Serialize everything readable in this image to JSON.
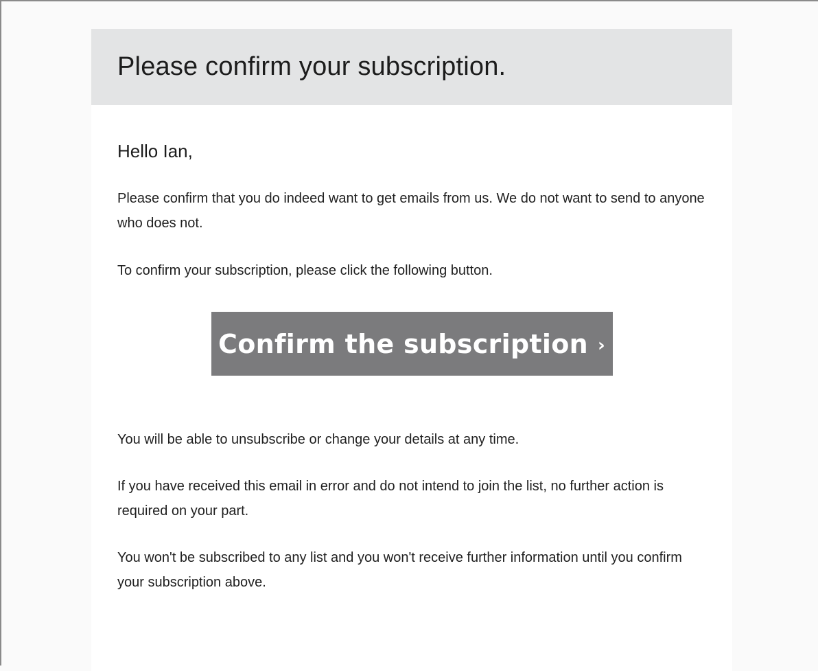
{
  "email": {
    "title": "Please confirm your subscription.",
    "greeting": "Hello Ian,",
    "paragraph_intro": "Please confirm that you do indeed want to get emails from us. We do not want to send to anyone who does not.",
    "paragraph_instruction": "To confirm your subscription, please click the following button.",
    "button_label": "Confirm the subscription",
    "button_icon": "›",
    "paragraph_unsubscribe": "You will be able to unsubscribe or change your details at any time.",
    "paragraph_error": "If you have received this email in error and do not intend to join the list, no further action is required on your part.",
    "paragraph_notice": "You won't be subscribed to any list and you won't receive further information until you confirm your subscription above."
  },
  "colors": {
    "header_background": "#e3e4e5",
    "button_background": "#7b7b7d",
    "button_text": "#ffffff",
    "page_background": "#fafafa"
  },
  "icons": {
    "button_icon_name": "chevron-right-icon"
  }
}
